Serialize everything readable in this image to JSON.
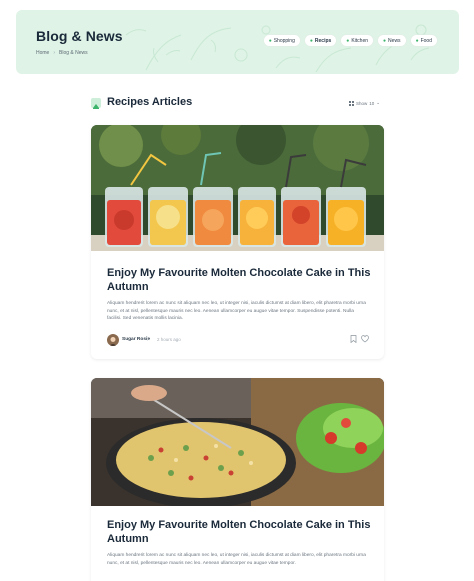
{
  "hero": {
    "title": "Blog & News",
    "breadcrumb": [
      "Home",
      "Blog & News"
    ],
    "categories": [
      "Shopping",
      "Recips",
      "Kitchen",
      "News",
      "Food"
    ],
    "active_category": "Recips"
  },
  "section": {
    "title": "Recipes Articles",
    "show_label": "Show",
    "show_value": "10"
  },
  "articles": [
    {
      "title": "Enjoy My Favourite Molten Chocolate Cake in This Autumn",
      "excerpt": "Aliquam hendrerit lorem ac nunc sit aliquam nec leo, ut integer nisi, iaculis dictumst at diam libero, elit pharetra morbi urna nunc, et at nisl, pellentesque mauris nec leo. Aenean ullamcorper eu augue vitae tempor. Suspendisse potenti. Nulla facilisi. Sed venenatis mollis lacinia.",
      "author": "Sugar Rosie",
      "time": "2 hours ago"
    },
    {
      "title": "Enjoy My Favourite Molten Chocolate Cake in This Autumn",
      "excerpt": "Aliquam hendrerit lorem ac nunc sit aliquam nec leo, ut integer nisi, iaculis dictumst at diam libero, elit pharetra morbi urna nunc, et at nisl, pellentesque mauris nec leo. Aenean ullamcorper eu augue vitae tempor."
    }
  ],
  "colors": {
    "hero_bg": "#dff3e6",
    "accent": "#3bb36a",
    "title": "#1b2a3a"
  }
}
